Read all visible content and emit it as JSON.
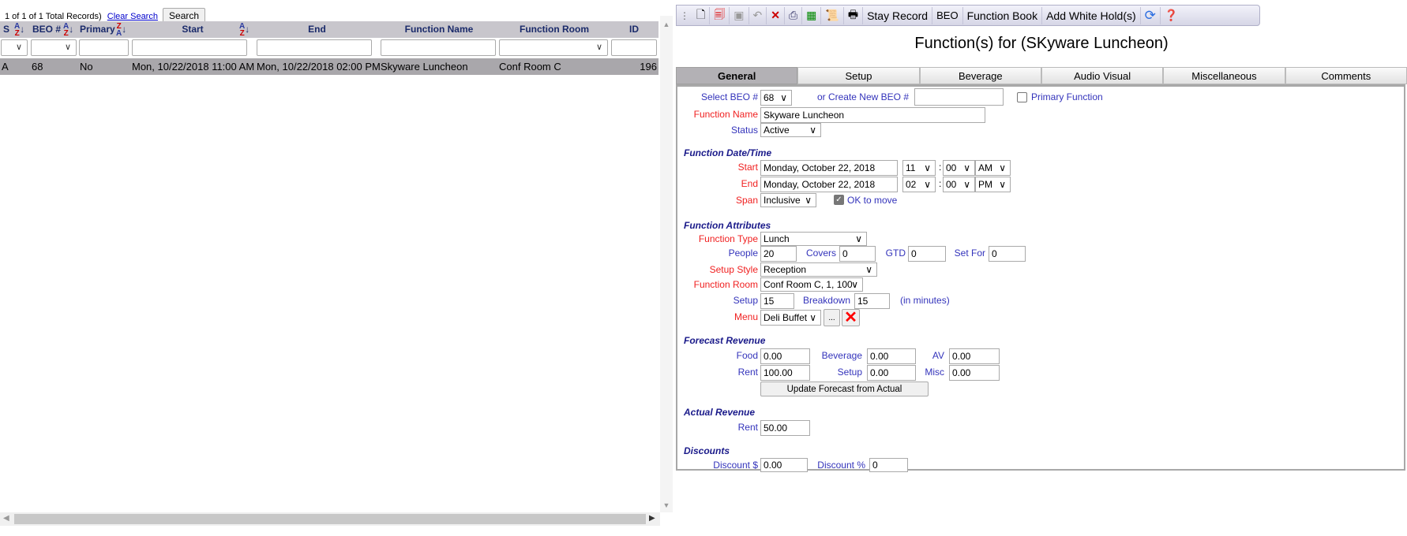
{
  "list": {
    "record_text": "1 of 1 of 1 Total Records)",
    "clear_search": "Clear Search",
    "search_button": "Search",
    "columns": [
      "S",
      "BEO #",
      "Primary",
      "Start",
      "End",
      "Function Name",
      "Function Room",
      "ID"
    ],
    "rows": [
      {
        "s": "A",
        "beo": "68",
        "primary": "No",
        "start": "Mon, 10/22/2018 11:00 AM",
        "end": "Mon, 10/22/2018 02:00 PM",
        "name": "Skyware Luncheon",
        "room": "Conf Room C",
        "id": "196"
      }
    ]
  },
  "toolbar": {
    "stay_record": "Stay Record",
    "beo": "BEO",
    "function_book": "Function Book",
    "add_white_hold": "Add White Hold(s)"
  },
  "title": "Function(s) for (SKyware Luncheon)",
  "tabs": [
    "General",
    "Setup",
    "Beverage",
    "Audio Visual",
    "Miscellaneous",
    "Comments"
  ],
  "form": {
    "select_beo_label": "Select BEO #",
    "select_beo": "68",
    "create_beo_label": "or Create New BEO #",
    "create_beo": "",
    "primary_label": "Primary Function",
    "name_label": "Function Name",
    "name": "Skyware Luncheon",
    "status_label": "Status",
    "status": "Active",
    "dt_header": "Function Date/Time",
    "start_label": "Start",
    "start_date": "Monday, October 22, 2018",
    "start_hour": "11",
    "start_min": "00",
    "start_ampm": "AM",
    "end_label": "End",
    "end_date": "Monday, October 22, 2018",
    "end_hour": "02",
    "end_min": "00",
    "end_ampm": "PM",
    "colon": ":",
    "span_label": "Span",
    "span": "Inclusive",
    "ok_move": "OK to move",
    "attr_header": "Function Attributes",
    "type_label": "Function Type",
    "type": "Lunch",
    "people_label": "People",
    "people": "20",
    "covers_label": "Covers",
    "covers": "0",
    "gtd_label": "GTD",
    "gtd": "0",
    "setfor_label": "Set For",
    "setfor": "0",
    "style_label": "Setup Style",
    "style": "Reception",
    "room_label": "Function Room",
    "room": "Conf Room C, 1, 100",
    "setup_label": "Setup",
    "setup": "15",
    "breakdown_label": "Breakdown",
    "breakdown": "15",
    "minutes": "(in minutes)",
    "menu_label": "Menu",
    "menu": "Deli Buffet",
    "ellipsis": "...",
    "forecast_header": "Forecast Revenue",
    "food_label": "Food",
    "food": "0.00",
    "bev_label": "Beverage",
    "bev": "0.00",
    "av_label": "AV",
    "av": "0.00",
    "rent_label": "Rent",
    "rent": "100.00",
    "fsetup_label": "Setup",
    "fsetup": "0.00",
    "misc_label": "Misc",
    "misc": "0.00",
    "update_button": "Update Forecast from Actual",
    "actual_header": "Actual Revenue",
    "arent_label": "Rent",
    "arent": "50.00",
    "disc_header": "Discounts",
    "disc_d_label": "Discount $",
    "disc_d": "0.00",
    "disc_p_label": "Discount %",
    "disc_p": "0"
  },
  "colors": {
    "label_blue": "#3333bb",
    "label_red": "#f02020",
    "header_navy": "#1a1a8a"
  }
}
